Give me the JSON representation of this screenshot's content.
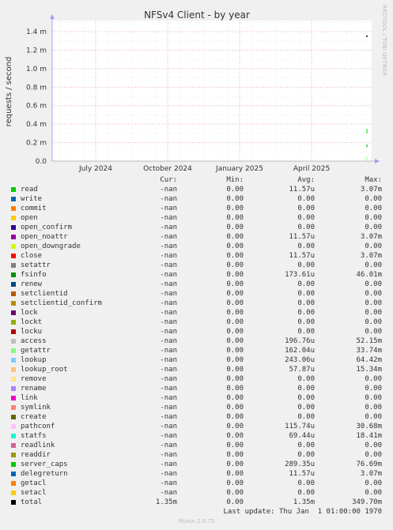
{
  "chart_data": {
    "type": "line",
    "title": "NFSv4 Client - by year",
    "ylabel": "requests / second",
    "watermark": "RRDTOOL / TOBI OETIKER",
    "x_tick_labels": [
      "July 2024",
      "October 2024",
      "January 2025",
      "April 2025"
    ],
    "y_tick_labels": [
      "0.0",
      "0.2 m",
      "0.4 m",
      "0.6 m",
      "0.8 m",
      "1.0 m",
      "1.2 m",
      "1.4 m"
    ],
    "ylim": [
      0,
      0.00152
    ],
    "grid": true,
    "legend_columns": [
      "Cur:",
      "Min:",
      "Avg:",
      "Max:"
    ],
    "series": [
      {
        "name": "read",
        "color": "#00cc00",
        "cur": "-nan",
        "min": "0.00",
        "avg": "11.57u",
        "max": "3.07m"
      },
      {
        "name": "write",
        "color": "#0066b3",
        "cur": "-nan",
        "min": "0.00",
        "avg": "0.00",
        "max": "0.00"
      },
      {
        "name": "commit",
        "color": "#ff8000",
        "cur": "-nan",
        "min": "0.00",
        "avg": "0.00",
        "max": "0.00"
      },
      {
        "name": "open",
        "color": "#ffcc00",
        "cur": "-nan",
        "min": "0.00",
        "avg": "0.00",
        "max": "0.00"
      },
      {
        "name": "open_confirm",
        "color": "#330099",
        "cur": "-nan",
        "min": "0.00",
        "avg": "0.00",
        "max": "0.00"
      },
      {
        "name": "open_noattr",
        "color": "#990099",
        "cur": "-nan",
        "min": "0.00",
        "avg": "11.57u",
        "max": "3.07m"
      },
      {
        "name": "open_downgrade",
        "color": "#ccff00",
        "cur": "-nan",
        "min": "0.00",
        "avg": "0.00",
        "max": "0.00"
      },
      {
        "name": "close",
        "color": "#ff0000",
        "cur": "-nan",
        "min": "0.00",
        "avg": "11.57u",
        "max": "3.07m"
      },
      {
        "name": "setattr",
        "color": "#808080",
        "cur": "-nan",
        "min": "0.00",
        "avg": "0.00",
        "max": "0.00"
      },
      {
        "name": "fsinfo",
        "color": "#008f00",
        "cur": "-nan",
        "min": "0.00",
        "avg": "173.61u",
        "max": "46.01m"
      },
      {
        "name": "renew",
        "color": "#00487d",
        "cur": "-nan",
        "min": "0.00",
        "avg": "0.00",
        "max": "0.00"
      },
      {
        "name": "setclientid",
        "color": "#b35a00",
        "cur": "-nan",
        "min": "0.00",
        "avg": "0.00",
        "max": "0.00"
      },
      {
        "name": "setclientid_confirm",
        "color": "#b38f00",
        "cur": "-nan",
        "min": "0.00",
        "avg": "0.00",
        "max": "0.00"
      },
      {
        "name": "lock",
        "color": "#6b006b",
        "cur": "-nan",
        "min": "0.00",
        "avg": "0.00",
        "max": "0.00"
      },
      {
        "name": "lockt",
        "color": "#8fb300",
        "cur": "-nan",
        "min": "0.00",
        "avg": "0.00",
        "max": "0.00"
      },
      {
        "name": "locku",
        "color": "#b30000",
        "cur": "-nan",
        "min": "0.00",
        "avg": "0.00",
        "max": "0.00"
      },
      {
        "name": "access",
        "color": "#bebebe",
        "cur": "-nan",
        "min": "0.00",
        "avg": "196.76u",
        "max": "52.15m"
      },
      {
        "name": "getattr",
        "color": "#80ff80",
        "cur": "-nan",
        "min": "0.00",
        "avg": "162.04u",
        "max": "33.74m"
      },
      {
        "name": "lookup",
        "color": "#80c9ff",
        "cur": "-nan",
        "min": "0.00",
        "avg": "243.06u",
        "max": "64.42m"
      },
      {
        "name": "lookup_root",
        "color": "#ffc080",
        "cur": "-nan",
        "min": "0.00",
        "avg": "57.87u",
        "max": "15.34m"
      },
      {
        "name": "remove",
        "color": "#ffe680",
        "cur": "-nan",
        "min": "0.00",
        "avg": "0.00",
        "max": "0.00"
      },
      {
        "name": "rename",
        "color": "#aa80ff",
        "cur": "-nan",
        "min": "0.00",
        "avg": "0.00",
        "max": "0.00"
      },
      {
        "name": "link",
        "color": "#ee00cc",
        "cur": "-nan",
        "min": "0.00",
        "avg": "0.00",
        "max": "0.00"
      },
      {
        "name": "symlink",
        "color": "#ff8080",
        "cur": "-nan",
        "min": "0.00",
        "avg": "0.00",
        "max": "0.00"
      },
      {
        "name": "create",
        "color": "#666600",
        "cur": "-nan",
        "min": "0.00",
        "avg": "0.00",
        "max": "0.00"
      },
      {
        "name": "pathconf",
        "color": "#ffbfff",
        "cur": "-nan",
        "min": "0.00",
        "avg": "115.74u",
        "max": "30.68m"
      },
      {
        "name": "statfs",
        "color": "#00ffcc",
        "cur": "-nan",
        "min": "0.00",
        "avg": "69.44u",
        "max": "18.41m"
      },
      {
        "name": "readlink",
        "color": "#cc6699",
        "cur": "-nan",
        "min": "0.00",
        "avg": "0.00",
        "max": "0.00"
      },
      {
        "name": "readdir",
        "color": "#999900",
        "cur": "-nan",
        "min": "0.00",
        "avg": "0.00",
        "max": "0.00"
      },
      {
        "name": "server_caps",
        "color": "#00cc00",
        "cur": "-nan",
        "min": "0.00",
        "avg": "289.35u",
        "max": "76.69m"
      },
      {
        "name": "delegreturn",
        "color": "#0066b3",
        "cur": "-nan",
        "min": "0.00",
        "avg": "11.57u",
        "max": "3.07m"
      },
      {
        "name": "getacl",
        "color": "#ff8000",
        "cur": "-nan",
        "min": "0.00",
        "avg": "0.00",
        "max": "0.00"
      },
      {
        "name": "setacl",
        "color": "#ffcc00",
        "cur": "-nan",
        "min": "0.00",
        "avg": "0.00",
        "max": "0.00"
      },
      {
        "name": "total",
        "color": "#000000",
        "cur": "1.35m",
        "min": "0.00",
        "avg": "1.35m",
        "max": "349.70m"
      }
    ],
    "last_update": "Last update: Thu Jan  1 01:00:00 1970",
    "footer": "Munin 2.0.75"
  }
}
